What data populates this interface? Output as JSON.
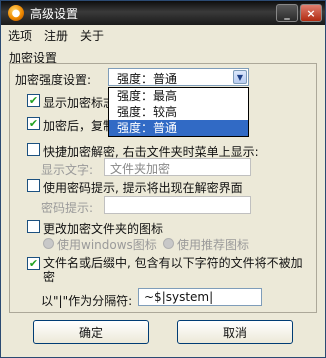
{
  "window": {
    "title": "高级设置",
    "icon": "app-logo-icon",
    "minimize_glyph": "_",
    "close_glyph": "×"
  },
  "menu": [
    "选项",
    "注册",
    "关于"
  ],
  "group": {
    "title": "加密设置"
  },
  "strength": {
    "label": "加密强度设置:",
    "value": "强度：普通",
    "options": [
      "强度：最高",
      "强度：较高",
      "强度：普通"
    ],
    "selected_index": 2
  },
  "options": {
    "show_encrypt": {
      "label": "显示加密标志",
      "checked": true
    },
    "after_encrypt": {
      "label": "加密后，复制",
      "checked": true
    },
    "quick_decrypt": {
      "label": "快捷加密解密, 右击文件夹时菜单上显示:",
      "checked": false
    },
    "display_text": {
      "label": "显示文字:",
      "value": "文件夹加密"
    },
    "use_hint": {
      "label": "使用密码提示, 提示将出现在解密界面",
      "checked": false
    },
    "hint": {
      "label": "密码提示:",
      "value": ""
    },
    "change_icon": {
      "label": "更改加密文件夹的图标",
      "checked": false
    },
    "icon_windows": {
      "label": "使用windows图标"
    },
    "icon_recommended": {
      "label": "使用推荐图标"
    },
    "exclude_chars": {
      "label": "文件名或后缀中, 包含有以下字符的文件将不被加密",
      "checked": true
    },
    "separator": {
      "label": "以\"|\"作为分隔符:",
      "value": "~$|system|"
    }
  },
  "buttons": {
    "ok": "确定",
    "cancel": "取消"
  }
}
